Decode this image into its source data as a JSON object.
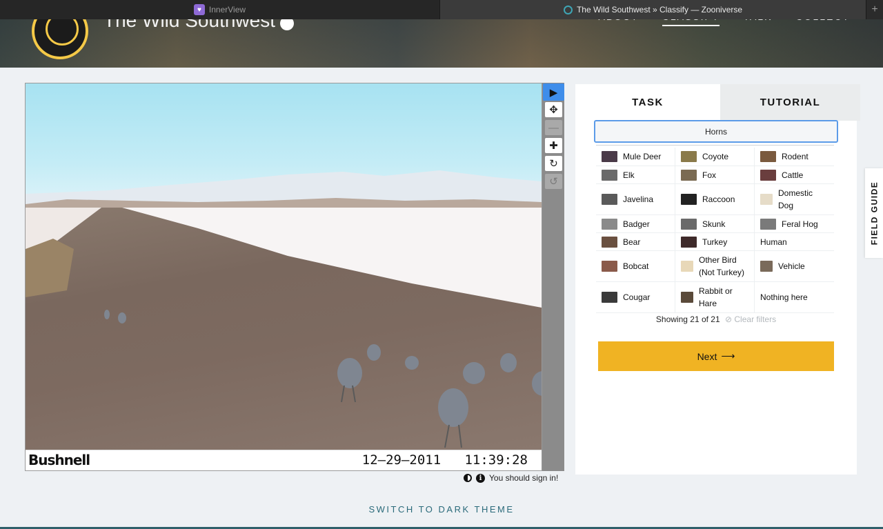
{
  "browser": {
    "tabs": [
      {
        "title": "InnerView",
        "active": false
      },
      {
        "title": "The Wild Southwest » Classify — Zooniverse",
        "active": true
      }
    ],
    "new_tab_label": "+"
  },
  "project": {
    "title": "The Wild Southwest",
    "nav": [
      "ABOUT",
      "CLASSIFY",
      "TALK",
      "COLLECT"
    ],
    "active_nav": "CLASSIFY"
  },
  "subject": {
    "camera_brand": "Bushnell",
    "date": "12–29–2011",
    "time": "11:39:28"
  },
  "toolbar": {
    "tools": [
      "pointer-icon",
      "move-icon",
      "zoom-out-icon",
      "zoom-in-icon",
      "rotate-icon",
      "reset-icon"
    ]
  },
  "under_viewer": {
    "signin_text": "You should sign in!"
  },
  "panel": {
    "tabs": [
      "TASK",
      "TUTORIAL"
    ],
    "filter_label": "Horns",
    "choices": [
      {
        "label": "Mule Deer",
        "color": "#4a3a48"
      },
      {
        "label": "Coyote",
        "color": "#8a7a4a"
      },
      {
        "label": "Rodent",
        "color": "#7a5a3e"
      },
      {
        "label": "Elk",
        "color": "#6a6a6a"
      },
      {
        "label": "Fox",
        "color": "#7a6a52"
      },
      {
        "label": "Cattle",
        "color": "#6a3e3e"
      },
      {
        "label": "Javelina",
        "color": "#5a5a5a"
      },
      {
        "label": "Raccoon",
        "color": "#222222"
      },
      {
        "label": "Domestic Dog",
        "color": "#e6dcc8"
      },
      {
        "label": "Badger",
        "color": "#8a8a8a"
      },
      {
        "label": "Skunk",
        "color": "#6a6a6a"
      },
      {
        "label": "Feral Hog",
        "color": "#7a7a7a"
      },
      {
        "label": "Bear",
        "color": "#6a5040"
      },
      {
        "label": "Turkey",
        "color": "#3e2a2a"
      },
      {
        "label": "Human",
        "color": ""
      },
      {
        "label": "Bobcat",
        "color": "#8a5a4a"
      },
      {
        "label": "Other Bird (Not Turkey)",
        "color": "#e8d8b8"
      },
      {
        "label": "Vehicle",
        "color": "#7a6a5a"
      },
      {
        "label": "Cougar",
        "color": "#3a3a3a"
      },
      {
        "label": "Rabbit or Hare",
        "color": "#5a4a3a"
      },
      {
        "label": "Nothing here",
        "color": ""
      }
    ],
    "showing_text": "Showing 21 of 21",
    "clear_filters": "Clear filters",
    "next_label": "Next"
  },
  "field_guide_label": "FIELD GUIDE",
  "footer": {
    "dark_theme_label": "SWITCH TO DARK THEME"
  }
}
